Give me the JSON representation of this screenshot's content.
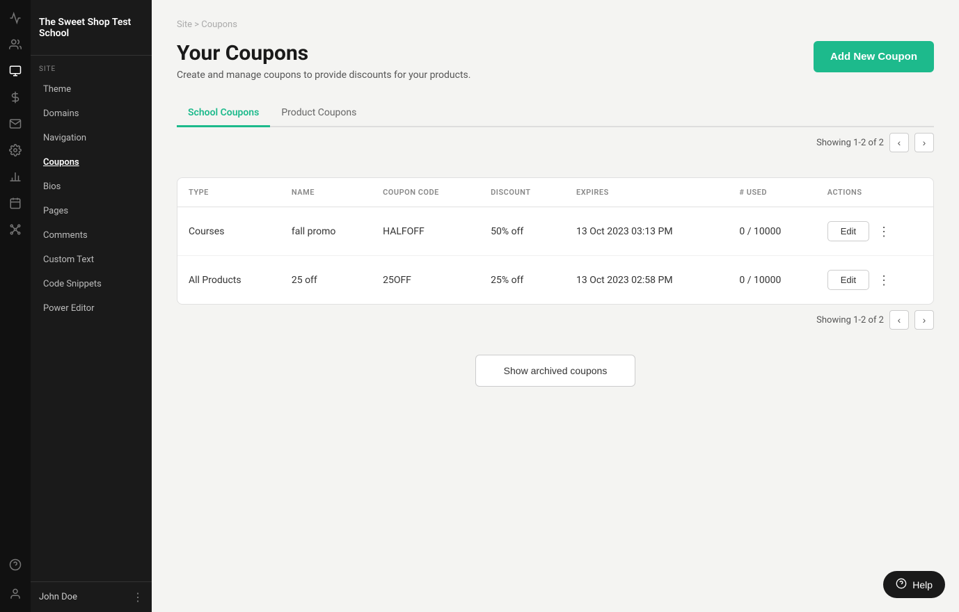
{
  "school": {
    "name": "The Sweet Shop Test School"
  },
  "sidebar": {
    "site_label": "SITE",
    "nav_items": [
      {
        "id": "theme",
        "label": "Theme"
      },
      {
        "id": "domains",
        "label": "Domains"
      },
      {
        "id": "navigation",
        "label": "Navigation"
      },
      {
        "id": "coupons",
        "label": "Coupons",
        "active": true
      },
      {
        "id": "bios",
        "label": "Bios"
      },
      {
        "id": "pages",
        "label": "Pages"
      },
      {
        "id": "comments",
        "label": "Comments"
      },
      {
        "id": "custom-text",
        "label": "Custom Text"
      },
      {
        "id": "code-snippets",
        "label": "Code Snippets"
      },
      {
        "id": "power-editor",
        "label": "Power Editor"
      }
    ],
    "user": {
      "name": "John Doe"
    }
  },
  "breadcrumb": {
    "site": "Site",
    "separator": ">",
    "current": "Coupons"
  },
  "header": {
    "title": "Your Coupons",
    "subtitle": "Create and manage coupons to provide discounts for your products.",
    "add_button_label": "Add New Coupon"
  },
  "tabs": [
    {
      "id": "school-coupons",
      "label": "School Coupons",
      "active": true
    },
    {
      "id": "product-coupons",
      "label": "Product Coupons",
      "active": false
    }
  ],
  "pagination": {
    "showing": "Showing 1-2 of 2"
  },
  "table": {
    "columns": [
      {
        "id": "type",
        "label": "TYPE"
      },
      {
        "id": "name",
        "label": "NAME"
      },
      {
        "id": "coupon_code",
        "label": "COUPON CODE"
      },
      {
        "id": "discount",
        "label": "DISCOUNT"
      },
      {
        "id": "expires",
        "label": "EXPIRES"
      },
      {
        "id": "used",
        "label": "# USED"
      },
      {
        "id": "actions",
        "label": "ACTIONS"
      }
    ],
    "rows": [
      {
        "type": "Courses",
        "name": "fall promo",
        "coupon_code": "HALFOFF",
        "discount": "50% off",
        "expires": "13 Oct 2023 03:13 PM",
        "used": "0 / 10000",
        "edit_label": "Edit"
      },
      {
        "type": "All Products",
        "name": "25 off",
        "coupon_code": "25OFF",
        "discount": "25% off",
        "expires": "13 Oct 2023 02:58 PM",
        "used": "0 / 10000",
        "edit_label": "Edit"
      }
    ]
  },
  "archive_button": {
    "label": "Show archived coupons"
  },
  "help": {
    "label": "Help"
  }
}
